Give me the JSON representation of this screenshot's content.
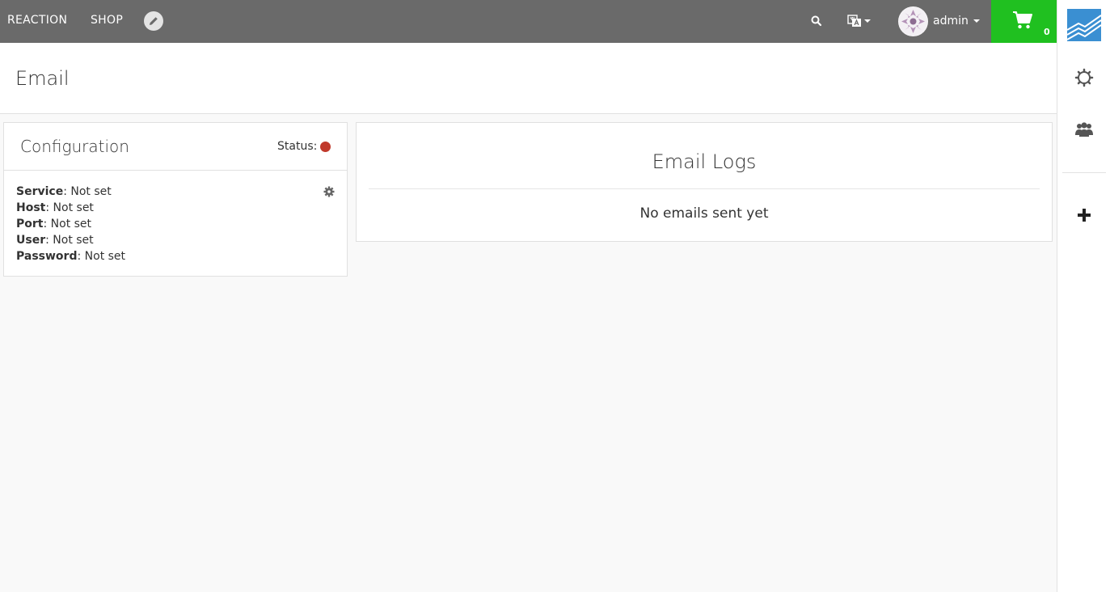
{
  "navbar": {
    "brand": "REACTION",
    "shop_link": "SHOP",
    "username": "admin",
    "cart_count": "0",
    "icons": [
      "pencil-icon",
      "search-icon",
      "language-icon",
      "avatar",
      "cart-icon"
    ]
  },
  "admin_sidebar": {
    "icons": [
      "reaction-logo",
      "settings-icon",
      "users-icon",
      "plus-icon"
    ]
  },
  "page": {
    "title": "Email"
  },
  "config": {
    "title": "Configuration",
    "status_label": "Status:",
    "status_color": "#c0392b",
    "rows": [
      {
        "label": "Service",
        "sep": ":",
        "value": "Not set"
      },
      {
        "label": "Host",
        "sep": ":",
        "value": "Not set"
      },
      {
        "label": "Port",
        "sep": ":",
        "value": "Not set"
      },
      {
        "label": "User",
        "sep": ":",
        "value": "Not set"
      },
      {
        "label": "Password",
        "sep": ": ",
        "value": "Not set"
      }
    ]
  },
  "logs": {
    "title": "Email Logs",
    "empty_message": "No emails sent yet"
  },
  "colors": {
    "navbar": "#6a6a6a",
    "cart": "#20c020",
    "logo": "#3a8fd2"
  }
}
